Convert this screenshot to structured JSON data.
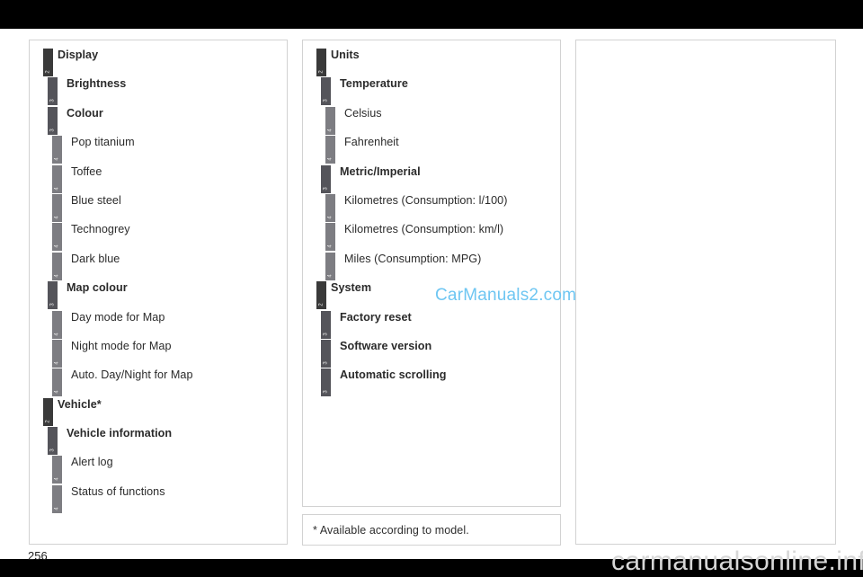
{
  "page": {
    "number": "256",
    "background_color": "#000000",
    "sheet_color": "#ffffff"
  },
  "watermarks": {
    "center": "CarManuals2.com",
    "center_color": "#6ec6f2",
    "bottom": "carmanualsonline.info",
    "bottom_color": "#d7d7d7"
  },
  "footnote": {
    "text": "* Available according to model."
  },
  "levels": {
    "l2_color": "#3a3a3a",
    "l3_color": "#54545a",
    "l4_color": "#7d7d82"
  },
  "columns": [
    {
      "name": "left-column",
      "items": [
        {
          "level": "2",
          "label": "Display"
        },
        {
          "level": "3",
          "label": "Brightness"
        },
        {
          "level": "3",
          "label": "Colour"
        },
        {
          "level": "4",
          "label": "Pop titanium"
        },
        {
          "level": "4",
          "label": "Toffee"
        },
        {
          "level": "4",
          "label": "Blue steel"
        },
        {
          "level": "4",
          "label": "Technogrey"
        },
        {
          "level": "4",
          "label": "Dark blue"
        },
        {
          "level": "3",
          "label": "Map colour"
        },
        {
          "level": "4",
          "label": "Day mode for Map"
        },
        {
          "level": "4",
          "label": "Night mode for Map"
        },
        {
          "level": "4",
          "label": "Auto. Day/Night for Map"
        },
        {
          "level": "2",
          "label": "Vehicle*"
        },
        {
          "level": "3",
          "label": "Vehicle information"
        },
        {
          "level": "4",
          "label": "Alert log"
        },
        {
          "level": "4",
          "label": "Status of functions"
        }
      ]
    },
    {
      "name": "middle-column",
      "items": [
        {
          "level": "2",
          "label": "Units"
        },
        {
          "level": "3",
          "label": "Temperature"
        },
        {
          "level": "4",
          "label": "Celsius"
        },
        {
          "level": "4",
          "label": "Fahrenheit"
        },
        {
          "level": "3",
          "label": "Metric/Imperial"
        },
        {
          "level": "4",
          "label": "Kilometres (Consumption: l/100)"
        },
        {
          "level": "4",
          "label": "Kilometres (Consumption: km/l)"
        },
        {
          "level": "4",
          "label": "Miles (Consumption: MPG)"
        },
        {
          "level": "2",
          "label": "System"
        },
        {
          "level": "3",
          "label": "Factory reset"
        },
        {
          "level": "3",
          "label": "Software version"
        },
        {
          "level": "3",
          "label": "Automatic scrolling"
        }
      ]
    },
    {
      "name": "right-column",
      "items": []
    }
  ]
}
